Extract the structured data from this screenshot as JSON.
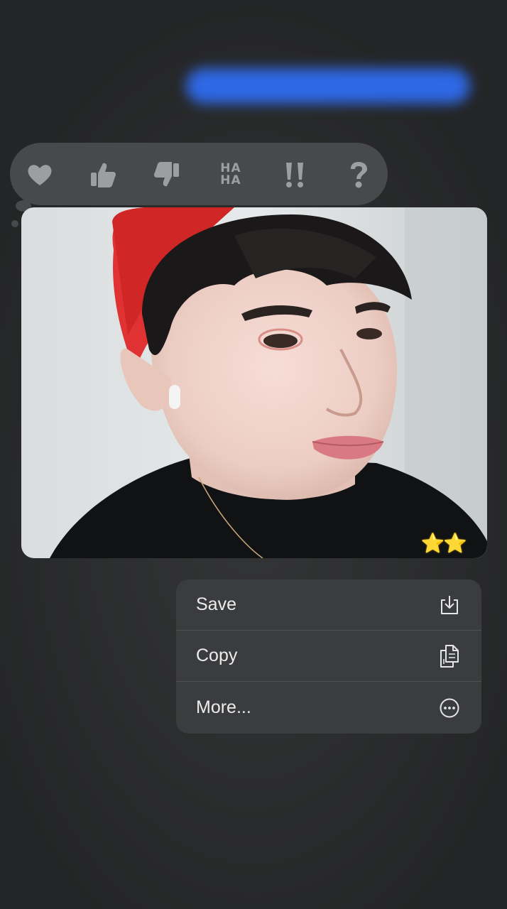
{
  "background_message": {
    "bubble_color": "#2f6cf0"
  },
  "tapback_bar": {
    "reactions": [
      {
        "name": "heart",
        "icon": "heart-icon"
      },
      {
        "name": "thumbs-up",
        "icon": "thumbs-up-icon"
      },
      {
        "name": "thumbs-down",
        "icon": "thumbs-down-icon"
      },
      {
        "name": "haha",
        "icon": "haha-icon",
        "line1": "HA",
        "line2": "HA"
      },
      {
        "name": "emphasize",
        "icon": "double-exclamation-icon",
        "label": "!!"
      },
      {
        "name": "question",
        "icon": "question-icon",
        "label": "?"
      }
    ],
    "icon_color": "#9c9ea2"
  },
  "photo": {
    "description": "selfie photo",
    "stars": "⭐⭐"
  },
  "context_menu": {
    "items": [
      {
        "label": "Save",
        "icon": "save-icon"
      },
      {
        "label": "Copy",
        "icon": "copy-icon"
      },
      {
        "label": "More...",
        "icon": "more-icon"
      }
    ]
  }
}
